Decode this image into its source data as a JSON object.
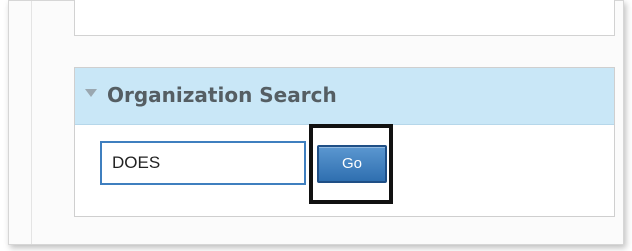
{
  "organization_search": {
    "title": "Organization Search",
    "input_value": "DOES",
    "go_label": "Go"
  },
  "colors": {
    "header_background": "#c9e7f7",
    "button_blue": "#2f6fb0",
    "input_border": "#3f7fbf",
    "highlight_border": "#111111"
  },
  "icons": {
    "collapse_toggle": "triangle-down-icon"
  }
}
